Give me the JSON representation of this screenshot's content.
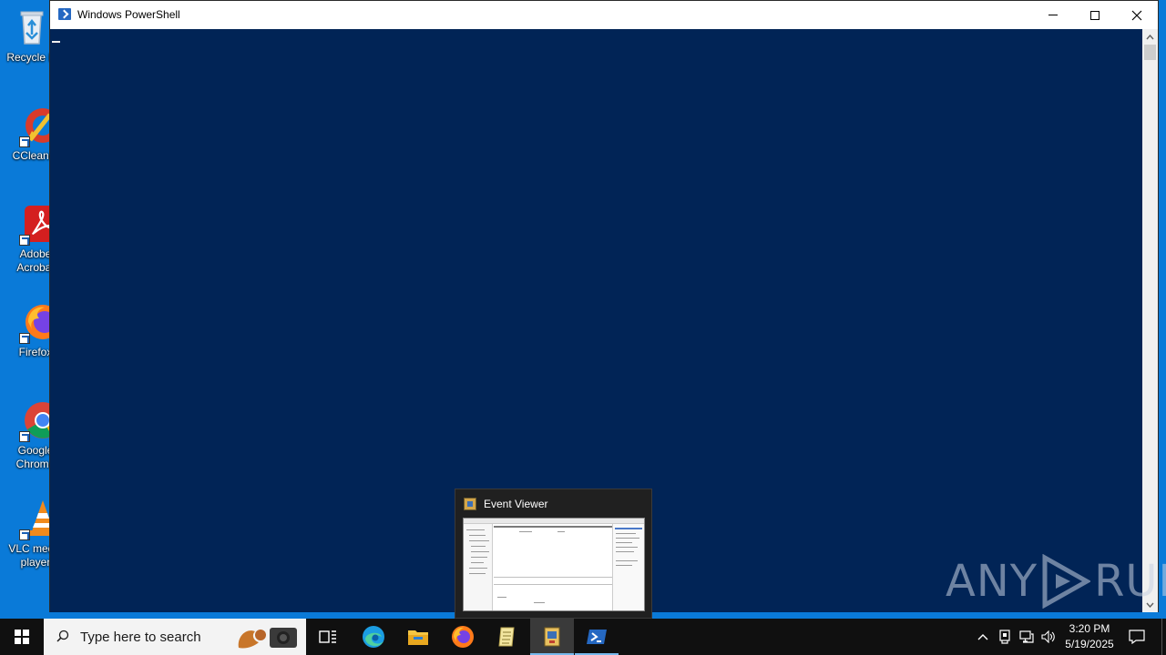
{
  "desktop": {
    "icons": [
      {
        "label": "Recycle Bin",
        "icon": "recycle-bin-icon"
      },
      {
        "label": "CCleaner",
        "icon": "ccleaner-icon"
      },
      {
        "label": "Adobe Acrobat",
        "icon": "adobe-acrobat-icon"
      },
      {
        "label": "Firefox",
        "icon": "firefox-icon"
      },
      {
        "label": "Google Chrome",
        "icon": "chrome-icon"
      },
      {
        "label": "VLC media player",
        "icon": "vlc-icon"
      }
    ]
  },
  "window": {
    "title": "Windows PowerShell",
    "background": "#012456",
    "controls": {
      "minimize": "minimize",
      "maximize": "maximize",
      "close": "close"
    }
  },
  "preview": {
    "title": "Event Viewer"
  },
  "watermark": {
    "left": "ANY",
    "right": "RUN"
  },
  "taskbar": {
    "search_placeholder": "Type here to search",
    "apps": [
      {
        "name": "task-view",
        "icon": "task-view-icon"
      },
      {
        "name": "edge",
        "icon": "edge-icon"
      },
      {
        "name": "file-explorer",
        "icon": "folder-icon"
      },
      {
        "name": "firefox",
        "icon": "firefox-icon"
      },
      {
        "name": "notepad",
        "icon": "notepad-icon"
      },
      {
        "name": "event-viewer",
        "icon": "event-viewer-icon"
      },
      {
        "name": "powershell",
        "icon": "powershell-icon"
      }
    ],
    "clock": {
      "time": "3:20 PM",
      "date": "5/19/2025"
    }
  },
  "colors": {
    "desktop": "#0a7ad8",
    "taskbar": "#101010",
    "accent": "#76b9ed"
  }
}
